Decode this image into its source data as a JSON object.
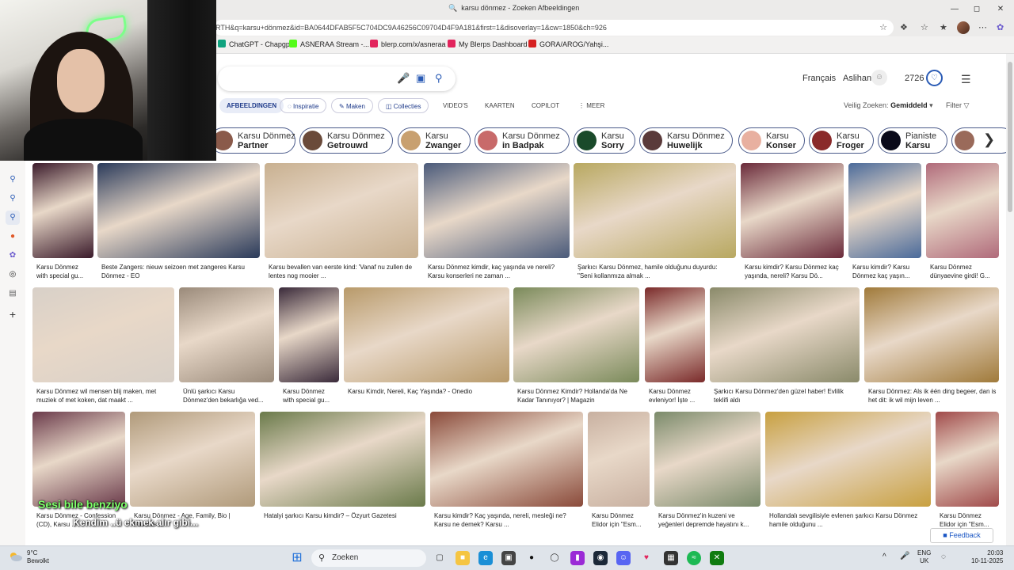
{
  "window": {
    "title": "karsu dönmez - Zoeken Afbeeldingen"
  },
  "address_bar": {
    "url": "RTH&q=karsu+dönmez&id=BA0644DFAB5F5C704DC9A46256C09704D4F9A181&first=1&disoverlay=1&cw=1850&ch=926"
  },
  "bookmarks": [
    {
      "label": "ChatGPT - Chapgpt",
      "color": "#10a37f"
    },
    {
      "label": "ASNERAA Stream -...",
      "color": "#53fc18"
    },
    {
      "label": "blerp.com/x/asneraa",
      "color": "#e2245c"
    },
    {
      "label": "My Blerps Dashboard",
      "color": "#e2245c"
    },
    {
      "label": "GORA/AROG/Yahşi...",
      "color": "#d62020"
    }
  ],
  "header": {
    "language": "Français",
    "user": "Aslihan",
    "points": "2726"
  },
  "tabs": [
    {
      "label": "AFBEELDINGEN",
      "style": "active"
    },
    {
      "label": "Inspiratie",
      "style": "pill"
    },
    {
      "label": "Maken",
      "style": "pill"
    },
    {
      "label": "Collecties",
      "style": "pill"
    },
    {
      "label": "VIDEO'S",
      "style": "plain"
    },
    {
      "label": "KAARTEN",
      "style": "plain"
    },
    {
      "label": "COPILOT",
      "style": "plain"
    },
    {
      "label": "MEER",
      "style": "plain"
    }
  ],
  "safe_search": {
    "label": "Veilig Zoeken:",
    "value": "Gemiddeld"
  },
  "filter_label": "Filter",
  "chips": [
    {
      "top": "Karsu Dönmez",
      "bottom": "Partner",
      "color": "#8a5a4a"
    },
    {
      "top": "Karsu Dönmez",
      "bottom": "Getrouwd",
      "color": "#6a4a3a"
    },
    {
      "top": "Karsu",
      "bottom": "Zwanger",
      "color": "#c8a070"
    },
    {
      "top": "Karsu Dönmez",
      "bottom": "in Badpak",
      "color": "#c86a6a"
    },
    {
      "top": "Karsu",
      "bottom": "Sorry",
      "color": "#1a4a2a"
    },
    {
      "top": "Karsu Dönmez",
      "bottom": "Huwelijk",
      "color": "#5a3a3a"
    },
    {
      "top": "Karsu",
      "bottom": "Konser",
      "color": "#e8b0a0"
    },
    {
      "top": "Karsu",
      "bottom": "Froger",
      "color": "#8a2a2a"
    },
    {
      "top": "Pianiste",
      "bottom": "Karsu",
      "color": "#0a0a1a"
    },
    {
      "top": "",
      "bottom": "",
      "color": "#9a6a5a"
    }
  ],
  "images": [
    {
      "caption": "Karsu Dönmez with special gu...",
      "color": "#3a1a2a"
    },
    {
      "caption": "Beste Zangers: nieuw seizoen met zangeres Karsu Dönmez - EO",
      "color": "#2a3a5a"
    },
    {
      "caption": "Karsu bevallen van eerste kind: 'Vanaf nu zullen de lentes nog mooier ...",
      "color": "#c8b090"
    },
    {
      "caption": "Karsu Dönmez kimdir, kaç yaşında ve nereli? Karsu konserleri ne zaman ...",
      "color": "#4a5a7a"
    },
    {
      "caption": "Şarkıcı Karsu Dönmez, hamile olduğunu duyurdu: \"Seni kollanmıza almak ...",
      "color": "#b8a860"
    },
    {
      "caption": "Karsu kimdir? Karsu Dönmez kaç yaşında, nereli? Karsu Dö...",
      "color": "#6a2a3a"
    },
    {
      "caption": "Karsu kimdir? Karsu Dönmez kaç yaşın...",
      "color": "#4a6a9a"
    },
    {
      "caption": "Karsu Dönmez dünyaevine girdi! G...",
      "color": "#b06a7a"
    },
    {
      "caption": "Karsu Dönmez wil mensen blij maken, met muziek of met koken, dat maakt ...",
      "color": "#d8d0c8"
    },
    {
      "caption": "Ünlü şarkıcı Karsu Dönmez'den bekarlığa ved...",
      "color": "#9a8a7a"
    },
    {
      "caption": "Karsu Dönmez with special gu...",
      "color": "#3a2a3a"
    },
    {
      "caption": "Karsu Kimdir, Nereli, Kaç Yaşında? - Onedio",
      "color": "#b89a6a"
    },
    {
      "caption": "Karsu Dönmez Kimdir? Hollanda'da Ne Kadar Tanınıyor? | Magazin",
      "color": "#7a8a5a"
    },
    {
      "caption": "Karsu Dönmez evleniyor! İşte ...",
      "color": "#7a2a2a"
    },
    {
      "caption": "Şarkıcı Karsu Dönmez'den güzel haber! Evlilik teklifi aldı",
      "color": "#8a8a6a"
    },
    {
      "caption": "Karsu Dönmez: Als ik één ding begeer, dan is het dit: ik wil mijn leven ...",
      "color": "#a07a3a"
    },
    {
      "caption": "Karsu Dönmez - Confession (CD), Karsu ...",
      "color": "#6a3a4a"
    },
    {
      "caption": "Karsu Dönmez - Age, Family, Bio | Famous ...",
      "color": "#b09a7a"
    },
    {
      "caption": "Hatalyi şarkıcı Karsu kimdir? – Özyurt Gazetesi",
      "color": "#6a7a4a"
    },
    {
      "caption": "Karsu kimdir? Kaç yaşında, nereli, mesleği ne? Karsu ne demek? Karsu ...",
      "color": "#8a4a3a"
    },
    {
      "caption": "Karsu Dönmez Elidor için \"Esm...",
      "color": "#c8b0a0"
    },
    {
      "caption": "Karsu Dönmez'in kuzeni ve yeğenleri depremde hayatını k...",
      "color": "#7a8a6a"
    },
    {
      "caption": "Hollandalı sevgilisiyle evlenen şarkıcı Karsu Dönmez hamile olduğunu ...",
      "color": "#c8a040"
    },
    {
      "caption": "Karsu Dönmez Elidor için \"Esm...",
      "color": "#a04a4a"
    }
  ],
  "stream_overlay": {
    "line1": "Sesi bile benziyo",
    "line2": "Kendim ..ü ekmek alır gibi..."
  },
  "feedback_label": "Feedback",
  "taskbar": {
    "weather_temp": "9°C",
    "weather_desc": "Bewolkt",
    "search_placeholder": "Zoeken",
    "lang": "ENG",
    "region": "UK",
    "time": "20:03",
    "date": "10-11-2025"
  }
}
